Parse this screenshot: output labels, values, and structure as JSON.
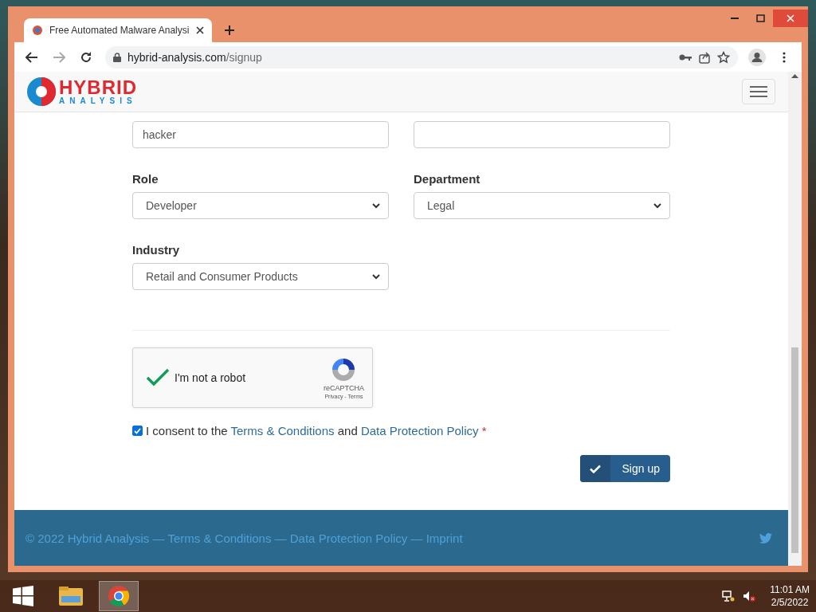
{
  "browser": {
    "tab_title": "Free Automated Malware Analysi",
    "url_host": "hybrid-analysis.com",
    "url_path": "/signup"
  },
  "site": {
    "logo_top": "HYBRID",
    "logo_bottom": "ANALYSIS"
  },
  "form": {
    "top_row": {
      "left_value": "hacker"
    },
    "selects": [
      {
        "label": "Role",
        "value": "Developer"
      },
      {
        "label": "Department",
        "value": "Legal"
      },
      {
        "label": "Industry",
        "value": "Retail and Consumer Products"
      }
    ],
    "captcha": {
      "checked": true,
      "label": "I'm not a robot",
      "brand": "reCAPTCHA",
      "links": "Privacy - Terms"
    },
    "consent": {
      "checked": true,
      "parts": [
        {
          "kind": "text",
          "text": "I consent to the"
        },
        {
          "kind": "link",
          "text": "Terms & Conditions"
        },
        {
          "kind": "text",
          "text": "and"
        },
        {
          "kind": "link",
          "text": "Data Protection Policy"
        },
        {
          "kind": "required",
          "text": "*"
        }
      ]
    },
    "submit": "Sign up"
  },
  "footer": {
    "copyright": "© 2022 Hybrid Analysis",
    "links": [
      {
        "separator": "—",
        "text": "Terms & Conditions"
      },
      {
        "separator": "—",
        "text": "Data Protection Policy"
      },
      {
        "separator": "—",
        "text": "Imprint"
      }
    ]
  },
  "taskbar": {
    "time": "11:01 AM",
    "date": "2/5/2022"
  }
}
